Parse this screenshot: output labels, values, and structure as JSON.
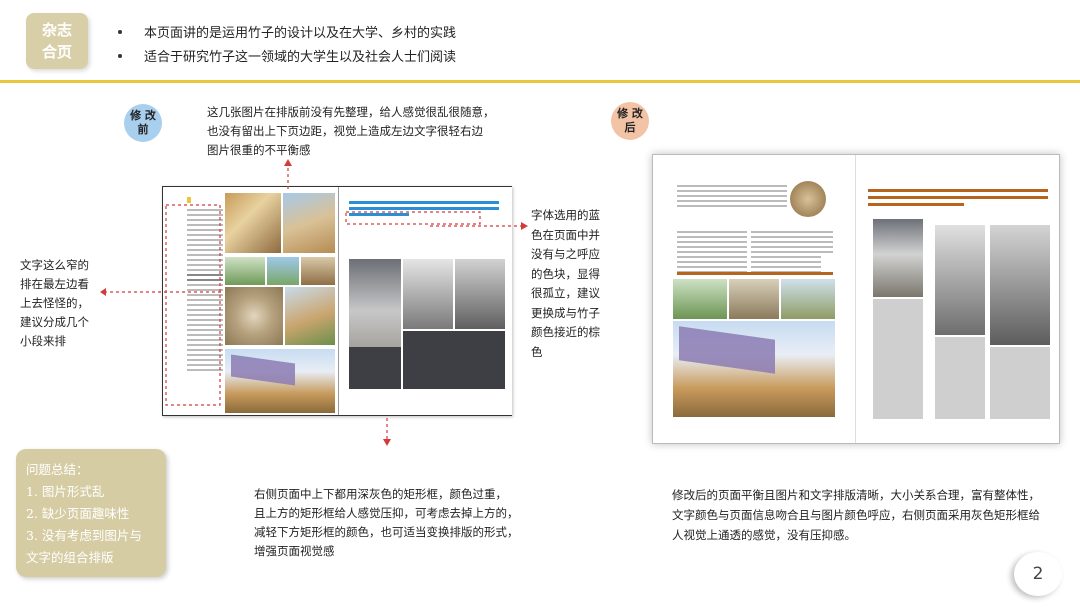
{
  "header": {
    "tag_line1": "杂志",
    "tag_line2": "合页",
    "bullets": [
      "本页面讲的是运用竹子的设计以及在大学、乡村的实践",
      "适合于研究竹子这一领域的大学生以及社会人士们阅读"
    ]
  },
  "badges": {
    "before_line1": "修 改",
    "before_line2": "前",
    "after_line1": "修 改",
    "after_line2": "后"
  },
  "notes": {
    "top_line1": "这几张图片在排版前没有先整理，给人感觉很乱很随意，",
    "top_line2": "也没有留出上下页边距，视觉上造成左边文字很轻右边",
    "top_line3": "图片很重的不平衡感",
    "left_line1": "文字这么窄的",
    "left_line2": "排在最左边看",
    "left_line3": "上去怪怪的，",
    "left_line4": "建议分成几个",
    "left_line5": "小段来排",
    "right_line1": "字体选用的蓝",
    "right_line2": "色在页面中并",
    "right_line3": "没有与之呼应",
    "right_line4": "的色块，显得",
    "right_line5": "很孤立，建议",
    "right_line6": "更换成与竹子",
    "right_line7": "颜色接近的棕",
    "right_line8": "色",
    "bottom_line1": "右侧页面中上下都用深灰色的矩形框，颜色过重，",
    "bottom_line2": "且上方的矩形框给人感觉压抑，可考虑去掉上方的，",
    "bottom_line3": "减轻下方矩形框的颜色，也可适当变换排版的形式，",
    "bottom_line4": "增强页面视觉感",
    "after_line1": "修改后的页面平衡且图片和文字排版清晰，大小关系合理，富有整体性，",
    "after_line2": "文字颜色与页面信息吻合且与图片颜色呼应，右侧页面采用灰色矩形框给",
    "after_line3": "人视觉上通透的感觉，没有压抑感。"
  },
  "summary": {
    "title": "问题总结：",
    "item1": "1. 图片形式乱",
    "item2": "2. 缺少页面趣味性",
    "item3_line1": "3. 没有考虑到图片与",
    "item3_line2": "文字的组合排版"
  },
  "page_number": "2",
  "colors": {
    "accent_yellow": "#e8c73a",
    "tag_beige": "#d8cfa9",
    "summary_beige": "#d6cca3",
    "badge_blue": "#a9cfee",
    "badge_peach": "#f3c3a6",
    "arrow_red": "#d33b3b",
    "heading_blue": "#2a8fd6",
    "heading_brown": "#b5651d"
  }
}
